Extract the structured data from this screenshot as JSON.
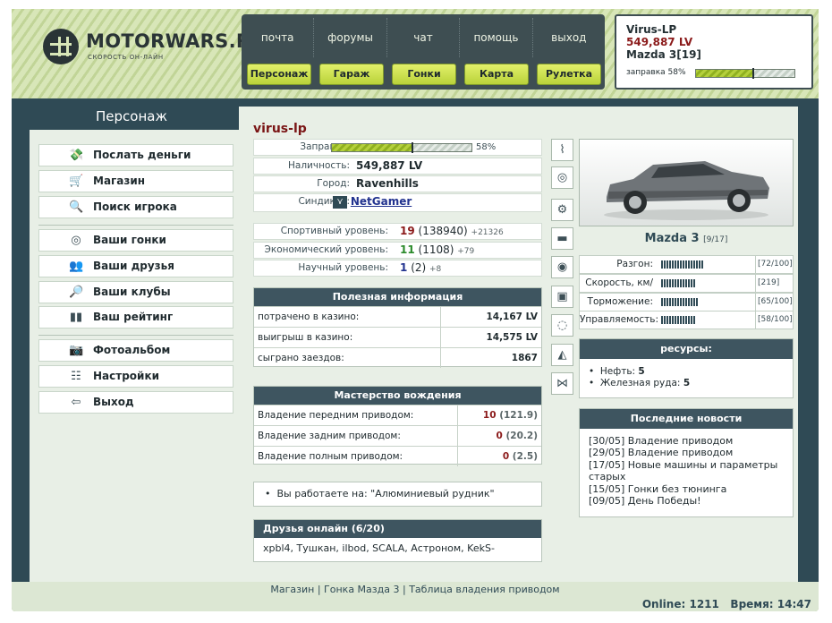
{
  "site": {
    "logo_text": "MOTORWARS.RU",
    "logo_sub": "СКОРОСТЬ ОН-ЛАЙН"
  },
  "topnav": {
    "links": [
      "почта",
      "форумы",
      "чат",
      "помощь",
      "выход"
    ],
    "buttons": [
      "Персонаж",
      "Гараж",
      "Гонки",
      "Карта",
      "Рулетка"
    ]
  },
  "userbox": {
    "name": "Virus-LP",
    "money": "549,887 LV",
    "car": "Mazda 3[19]",
    "fuel_label": "заправка 58%",
    "fuel_fraction": 0.58
  },
  "left": {
    "title": "Персонаж",
    "group1": [
      {
        "label": "Послать деньги",
        "icon": "money-icon"
      },
      {
        "label": "Магазин",
        "icon": "cart-icon"
      },
      {
        "label": "Поиск игрока",
        "icon": "search-icon"
      }
    ],
    "group2": [
      {
        "label": "Ваши гонки",
        "icon": "steering-wheel-icon"
      },
      {
        "label": "Ваши друзья",
        "icon": "friends-icon"
      },
      {
        "label": "Ваши клубы",
        "icon": "clubs-icon"
      },
      {
        "label": "Ваш рейтинг",
        "icon": "rating-icon"
      }
    ],
    "group3": [
      {
        "label": "Фотоальбом",
        "icon": "photo-icon"
      },
      {
        "label": "Настройки",
        "icon": "settings-icon"
      },
      {
        "label": "Выход",
        "icon": "exit-icon"
      }
    ]
  },
  "profile": {
    "name": "virus-lp",
    "fuel_key": "Заправка:",
    "fuel_value": "58%",
    "fuel_fraction": 0.58,
    "cash_key": "Наличность:",
    "cash_value": "549,887 LV",
    "city_key": "Город:",
    "city_value": "Ravenhills",
    "syndicate_key": "Синдикат:",
    "syndicate_value": "NetGamer",
    "levels": [
      {
        "key": "Спортивный уровень:",
        "level": "19",
        "points": "(138940)",
        "delta": "+21326"
      },
      {
        "key": "Экономический уровень:",
        "level": "11",
        "points": "(1108)",
        "delta": "+79"
      },
      {
        "key": "Научный уровень:",
        "level": "1",
        "points": "(2)",
        "delta": "+8"
      }
    ]
  },
  "useful": {
    "title": "Полезная информация",
    "rows": [
      {
        "k": "потрачено в казино:",
        "v": "14,167 LV"
      },
      {
        "k": "выигрыш в казино:",
        "v": "14,575 LV"
      },
      {
        "k": "сыграно заездов:",
        "v": "1867"
      }
    ]
  },
  "mastery": {
    "title": "Мастерство вождения",
    "rows": [
      {
        "k": "Владение передним приводом:",
        "v": "10",
        "p": "(121.9)"
      },
      {
        "k": "Владение задним приводом:",
        "v": "0",
        "p": "(20.2)"
      },
      {
        "k": "Владение полным приводом:",
        "v": "0",
        "p": "(2.5)"
      }
    ]
  },
  "work": {
    "text": "Вы работаете на: \"Алюминиевый рудник\""
  },
  "friends": {
    "title": "Друзья онлайн (6/20)",
    "list": "xpbl4, Тушкан, ilbod, SCALA, Астроном, KekS-"
  },
  "parts_icons": [
    "shock-absorber-icon",
    "tire-icon",
    "wheels-icon",
    "spoiler-icon",
    "brake-disc-icon",
    "engine-icon",
    "turbo-icon",
    "exhaust-icon",
    "suspension-icon"
  ],
  "car": {
    "name": "Mazda 3",
    "slots": "[9/17]",
    "stats": [
      {
        "k": "Разгон:",
        "v": "[72/100]",
        "fraction": 0.48
      },
      {
        "k": "Скорость, км/ч:",
        "v": "[219]",
        "fraction": 0.4
      },
      {
        "k": "Торможение:",
        "v": "[65/100]",
        "fraction": 0.43
      },
      {
        "k": "Управляемость:",
        "v": "[58/100]",
        "fraction": 0.4
      }
    ]
  },
  "resources": {
    "title": "ресурсы:",
    "items": [
      {
        "k": "Нефть:",
        "v": "5"
      },
      {
        "k": "Железная руда:",
        "v": "5"
      }
    ]
  },
  "news": {
    "title": "Последние новости",
    "items": [
      "[30/05] Владение приводом",
      "[29/05] Владение приводом",
      "[17/05] Новые машины и параметры старых",
      "[15/05] Гонки без тюнинга",
      "[09/05] День Победы!"
    ]
  },
  "footer": {
    "links": [
      "Магазин",
      "Гонка Мазда 3",
      "Таблица владения приводом"
    ],
    "online_label": "Online:",
    "online_value": "1211",
    "time_label": "Время:",
    "time_value": "14:47"
  }
}
